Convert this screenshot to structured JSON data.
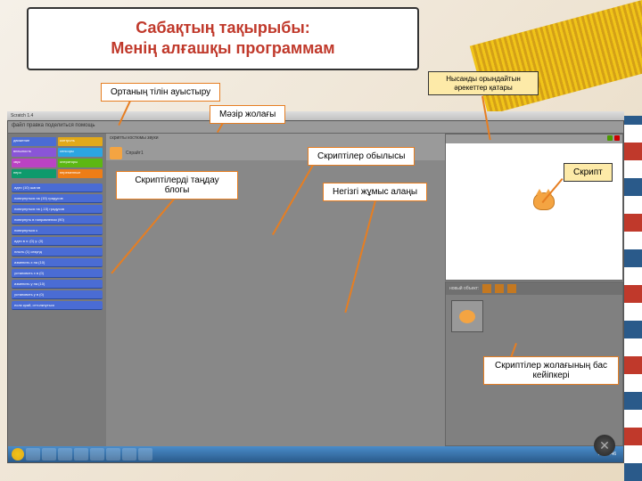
{
  "title": {
    "line1": "Сабақтың тақырыбы:",
    "line2": "Менің алғашқы программам"
  },
  "callouts": {
    "object_actions": "Нысанды орындайтын әрекеттер қатары",
    "language_switch": "Ортаның тілін ауыстыру",
    "menu_bar": "Мәзір жолағы",
    "script_area": "Скриптілер обылысы",
    "block_selection": "Скриптілерді таңдау блогы",
    "work_area": "Негізгі жұмыс алаңы",
    "script": "Скрипт",
    "sprite_row": "Скриптілер жолағының бас кейіпкері"
  },
  "scratch": {
    "window_title": "Scratch 1.4",
    "menu": "файл  правка  поделиться  помощь",
    "categories": {
      "motion": "движение",
      "looks": "внешность",
      "sound": "звук",
      "pen": "перо",
      "control": "контроль",
      "sensing": "сенсоры",
      "operators": "операторы",
      "variables": "переменные"
    },
    "blocks": [
      "идти (10) шагов",
      "повернуться на (15) градусов",
      "повернуться на (-15) градусов",
      "повернуть в направлении (90)",
      "повернуться к ",
      "идти в x: (0) y: (0)",
      "плыть (1) секунд",
      "изменить x на (10)",
      "установить x в (0)",
      "изменить y на (10)",
      "установить y в (0)",
      "если край, оттолкнуться"
    ],
    "tabs": "скрипты  костюмы  звуки",
    "sprite_name": "Спрайт1",
    "sprite_list_label": "новый объект:",
    "taskbar_time": "Ru  10:46"
  }
}
